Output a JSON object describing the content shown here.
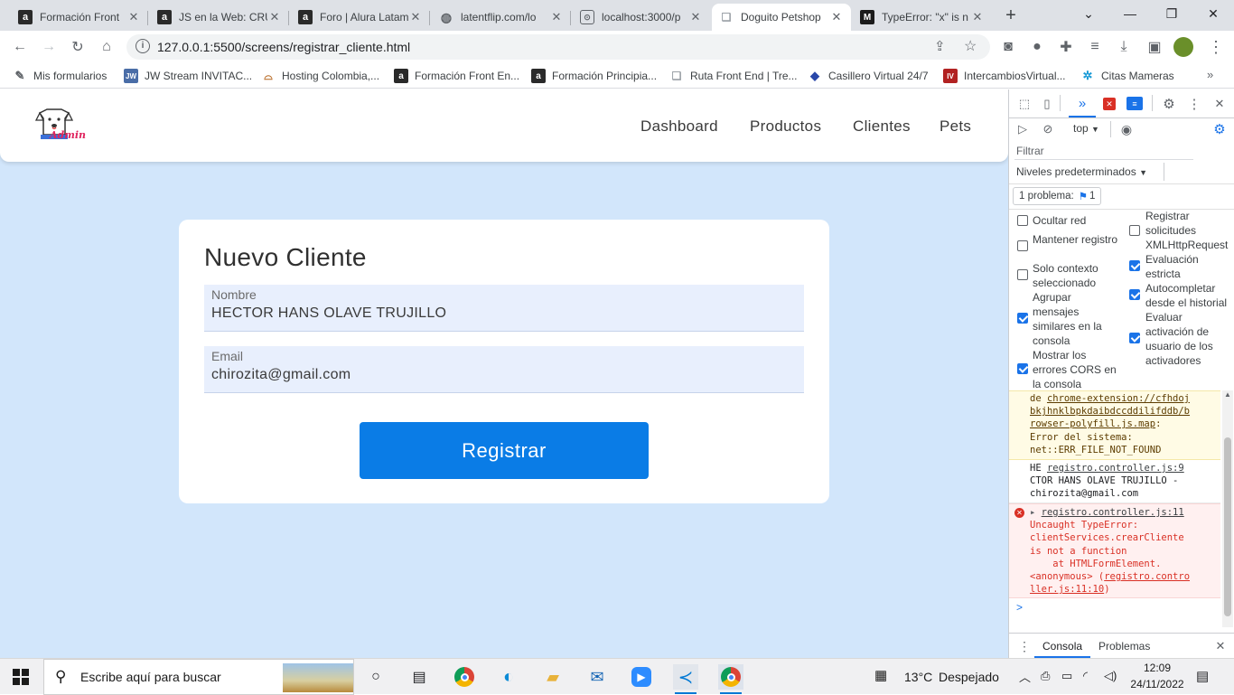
{
  "browser": {
    "tabs": [
      {
        "title": "Formación Front",
        "favicon": "a"
      },
      {
        "title": "JS en la Web: CRU",
        "favicon": "a"
      },
      {
        "title": "Foro | Alura Latam",
        "favicon": "a"
      },
      {
        "title": "latentflip.com/lo",
        "favicon": "globe"
      },
      {
        "title": "localhost:3000/p",
        "favicon": "page"
      },
      {
        "title": "Doguito Petshop",
        "favicon": "doc"
      },
      {
        "title": "TypeError: \"x\" is n",
        "favicon": "M"
      }
    ],
    "active_tab_index": 5,
    "new_tab": "+",
    "url": "127.0.0.1:5500/screens/registrar_cliente.html"
  },
  "bookmarks": [
    {
      "label": "Mis formularios",
      "icon": "pen-icon"
    },
    {
      "label": "JW Stream INVITAC...",
      "icon": "JW"
    },
    {
      "label": "Hosting Colombia,...",
      "icon": "hat-icon"
    },
    {
      "label": "Formación Front En...",
      "icon": "a"
    },
    {
      "label": "Formación Principia...",
      "icon": "a"
    },
    {
      "label": "Ruta Front End | Tre...",
      "icon": "doc-icon"
    },
    {
      "label": "Casillero Virtual 24/7",
      "icon": "diamond-icon"
    },
    {
      "label": "IntercambiosVirtual...",
      "icon": "IV"
    },
    {
      "label": "Citas Mameras",
      "icon": "gear-icon"
    }
  ],
  "app": {
    "logo_text": "Admin",
    "nav": [
      "Dashboard",
      "Productos",
      "Clientes",
      "Pets"
    ],
    "form": {
      "title": "Nuevo Cliente",
      "name_label": "Nombre",
      "name_value": "HECTOR HANS OLAVE TRUJILLO",
      "email_label": "Email",
      "email_value": "chirozita@gmail.com",
      "submit_label": "Registrar"
    }
  },
  "devtools": {
    "context": "top",
    "filter_placeholder": "Filtrar",
    "levels": "Niveles predeterminados",
    "issues": "1 problema:",
    "issues_count": "1",
    "options_left": [
      {
        "label": "Ocultar red",
        "checked": false
      },
      {
        "label": "Mantener registro",
        "checked": false
      },
      {
        "label": "Solo contexto seleccionado",
        "checked": false
      },
      {
        "label": "Agrupar mensajes similares en la consola",
        "checked": true
      },
      {
        "label": "Mostrar los errores CORS en la consola",
        "checked": true
      }
    ],
    "options_right": [
      {
        "label": "Registrar solicitudes XMLHttpRequest",
        "checked": false
      },
      {
        "label": "Evaluación estricta",
        "checked": true
      },
      {
        "label": "Autocompletar desde el historial",
        "checked": true
      },
      {
        "label": "Evaluar activación de usuario de los activadores",
        "checked": true
      }
    ],
    "warning": {
      "lines": [
        "de ",
        "chrome-extension://cfhdoj",
        "bkjhnklbpkdaibdccddilifddb/b",
        "rowser-polyfill.js.map",
        ":",
        "Error del sistema:",
        "net::ERR_FILE_NOT_FOUND"
      ]
    },
    "log": {
      "prefix": "HE",
      "source": "registro.controller.js:9",
      "line2": "CTOR HANS OLAVE TRUJILLO  -",
      "line3": "chirozita@gmail.com"
    },
    "error": {
      "source": "registro.controller.js:11",
      "line1": "Uncaught TypeError:",
      "line2": "clientServices.crearCliente",
      "line3": "is not a function",
      "line4": "    at HTMLFormElement.",
      "line5": "<anonymous> (",
      "link1": "registro.contro",
      "link2": "ller.js:11:10",
      "close": ")"
    },
    "prompt": ">",
    "drawer_tabs": [
      "Consola",
      "Problemas"
    ]
  },
  "taskbar": {
    "search_placeholder": "Escribe aquí para buscar",
    "weather_temp": "13°C",
    "weather_text": "Despejado",
    "time": "12:09",
    "date": "24/11/2022"
  },
  "colors": {
    "page_bg": "#d2e6fb",
    "button": "#0a7ce6",
    "field_bg": "#e8effd",
    "error_text": "#d93025",
    "warning_bg": "#fffbe5"
  }
}
